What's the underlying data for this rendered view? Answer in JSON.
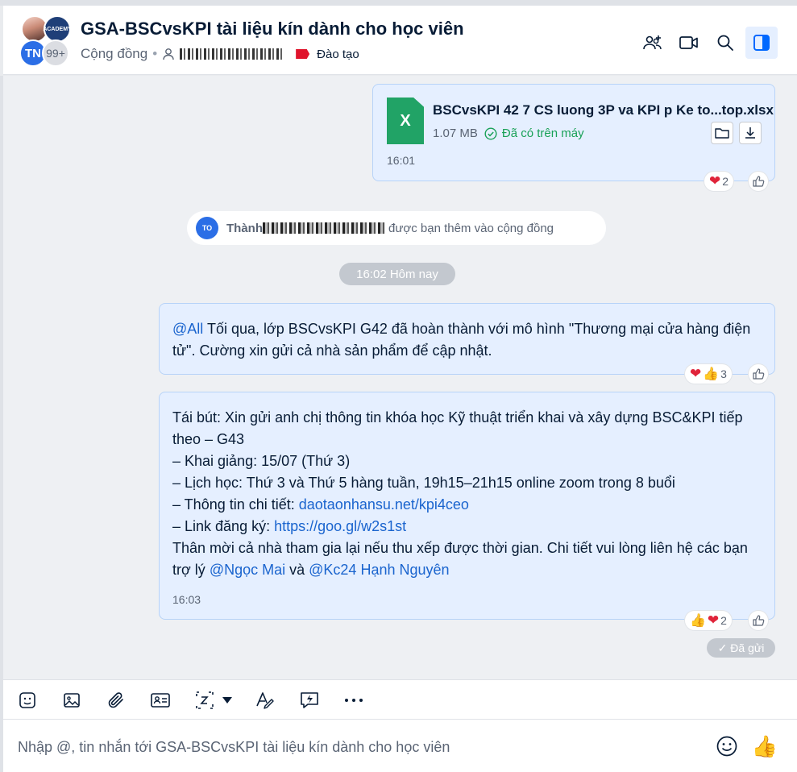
{
  "header": {
    "title": "GSA-BSCvsKPI tài liệu kín dành cho học viên",
    "type_label": "Cộng đồng",
    "tag_label": "Đào tạo",
    "avatar_initials": "TN",
    "avatar_more": "99+",
    "logo_text": "ACADEMY"
  },
  "messages": {
    "file": {
      "name": "BSCvsKPI 42 7 CS luong 3P va KPI p Ke to...top.xlsx",
      "ext_label": "X",
      "size": "1.07 MB",
      "status": "Đã có trên máy",
      "time": "16:01",
      "reaction_count": "2"
    },
    "system": {
      "avatar_initials": "TO",
      "name": "Thành",
      "text": "được bạn thêm vào cộng đồng"
    },
    "time_divider": "16:02 Hôm nay",
    "msg1": {
      "mention": "@All",
      "text": " Tối qua, lớp BSCvsKPI G42 đã hoàn thành với mô hình \"Thương mại cửa hàng điện tử\". Cường xin gửi cả nhà sản phẩm để cập nhật.",
      "reaction_count": "3"
    },
    "msg2": {
      "line1": "Tái bút: Xin gửi anh chị thông tin khóa học Kỹ thuật triển khai và xây dựng BSC&KPI tiếp theo – G43",
      "line2": "– Khai giảng: 15/07 (Thứ 3)",
      "line3": "– Lịch học: Thứ 3 và Thứ 5 hàng tuần, 19h15–21h15 online zoom trong 8 buổi",
      "line4_prefix": "– Thông tin chi tiết: ",
      "line4_link": "daotaonhansu.net/kpi4ceo",
      "line5_prefix": "– Link đăng ký: ",
      "line5_link": "https://goo.gl/w2s1st",
      "line6_prefix": "Thân mời cả nhà tham gia lại nếu thu xếp được thời gian. Chi tiết vui lòng liên hệ các bạn trợ lý ",
      "mention1": "@Ngọc Mai",
      "and": " và ",
      "mention2": "@Kc24 Hạnh Nguyên",
      "time": "16:03",
      "reaction_count": "2"
    },
    "sent_status": "✓ Đã gửi"
  },
  "composer": {
    "placeholder": "Nhập @, tin nhắn tới GSA-BSCvsKPI tài liệu kín dành cho học viên"
  },
  "colors": {
    "accent": "#1a64ce",
    "bubble": "#e5efff",
    "tag_red": "#e0142c",
    "excel_green": "#21a366"
  }
}
